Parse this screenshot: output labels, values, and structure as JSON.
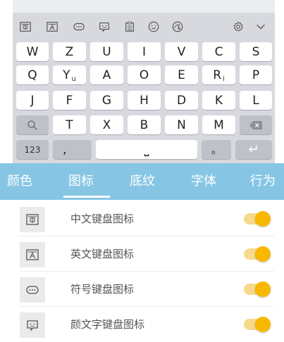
{
  "keyboard": {
    "toolbar_icons": [
      "chinese-keyboard-icon",
      "english-keyboard-icon",
      "symbol-keyboard-icon",
      "emoticon-keyboard-icon",
      "clipboard-icon",
      "emoji-icon",
      "theme-icon",
      "settings-icon",
      "collapse-keyboard-icon"
    ],
    "row1": [
      "W",
      "Z",
      "U",
      "I",
      "V",
      "C",
      "S"
    ],
    "row2": [
      {
        "main": "Q",
        "sup": ""
      },
      {
        "main": "Y",
        "sup": "u"
      },
      {
        "main": "A",
        "sup": ""
      },
      {
        "main": "O",
        "sup": ""
      },
      {
        "main": "E",
        "sup": ""
      },
      {
        "main": "R",
        "sup": "i"
      },
      {
        "main": "P",
        "sup": ""
      }
    ],
    "row3": [
      "J",
      "F",
      "G",
      "H",
      "D",
      "K",
      "L"
    ],
    "row4": [
      "T",
      "X",
      "B",
      "N",
      "M"
    ],
    "row5": {
      "num_label": "123",
      "comma_label": ",",
      "space_label": "⎵",
      "period_label": "。",
      "enter_label": "↵"
    }
  },
  "tabs": [
    {
      "label": "颜色"
    },
    {
      "label": "图标",
      "active": true
    },
    {
      "label": "底纹"
    },
    {
      "label": "字体"
    },
    {
      "label": "行为"
    }
  ],
  "list": [
    {
      "icon": "chinese-keyboard-icon",
      "label": "中文键盘图标",
      "enabled": true
    },
    {
      "icon": "english-keyboard-icon",
      "label": "英文键盘图标",
      "enabled": true
    },
    {
      "icon": "symbol-keyboard-icon",
      "label": "符号键盘图标",
      "enabled": true
    },
    {
      "icon": "emoticon-keyboard-icon",
      "label": "颜文字键盘图标",
      "enabled": true
    }
  ],
  "colors": {
    "tab_bar": "#86c6e4",
    "toggle_knob": "#f8b800",
    "toggle_track": "#f7d98c",
    "keyboard_bg": "#d7d9de"
  }
}
